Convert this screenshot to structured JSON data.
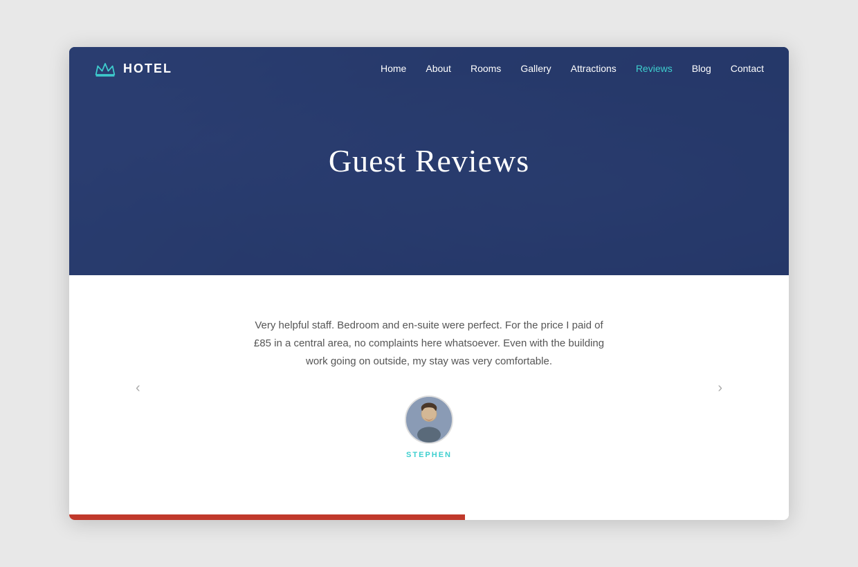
{
  "logo": {
    "text": "HOTEL",
    "icon_name": "crown-icon"
  },
  "nav": {
    "items": [
      {
        "label": "Home",
        "active": false
      },
      {
        "label": "About",
        "active": false
      },
      {
        "label": "Rooms",
        "active": false
      },
      {
        "label": "Gallery",
        "active": false
      },
      {
        "label": "Attractions",
        "active": false
      },
      {
        "label": "Reviews",
        "active": true
      },
      {
        "label": "Blog",
        "active": false
      },
      {
        "label": "Contact",
        "active": false
      }
    ]
  },
  "hero": {
    "title": "Guest Reviews"
  },
  "review": {
    "text": "Very helpful staff. Bedroom and en-suite were perfect. For the price I paid of £85 in a central area, no complaints here whatsoever. Even with the building work going on outside, my stay was very comfortable.",
    "reviewer_name": "STEPHEN"
  },
  "arrows": {
    "left": "‹",
    "right": "›"
  },
  "colors": {
    "accent": "#3ecfcf",
    "red_bar": "#c0392b",
    "hero_bg": "#2e4270",
    "nav_text": "#ffffff"
  }
}
